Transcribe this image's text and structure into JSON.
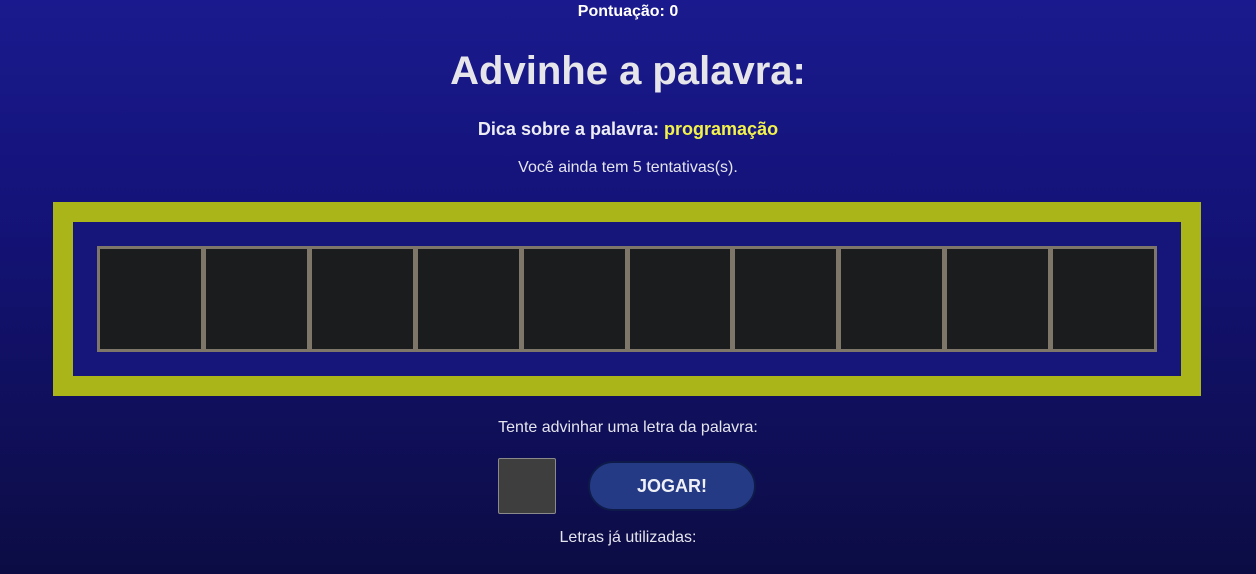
{
  "header": {
    "score_label": "Pontuação: 0"
  },
  "game": {
    "title": "Advinhe a palavra:",
    "hint_label": "Dica sobre a palavra:",
    "hint_value": "programação",
    "attempts_text": "Você ainda tem 5 tentativas(s).",
    "word_length": 10,
    "revealed_letters": [
      "",
      "",
      "",
      "",
      "",
      "",
      "",
      "",
      "",
      ""
    ]
  },
  "input": {
    "prompt": "Tente advinhar uma letra da palavra:",
    "letter_value": "",
    "play_button_label": "JOGAR!",
    "used_letters_label": "Letras já utilizadas:",
    "used_letters": ""
  },
  "colors": {
    "background_top": "#1a1a8e",
    "background_bottom": "#0c0c44",
    "board_frame": "#aab51a",
    "hint_accent": "#f2f24a",
    "slot_fill": "#1b1c1e",
    "slot_border": "#7f766a",
    "button_fill": "#243a85"
  }
}
